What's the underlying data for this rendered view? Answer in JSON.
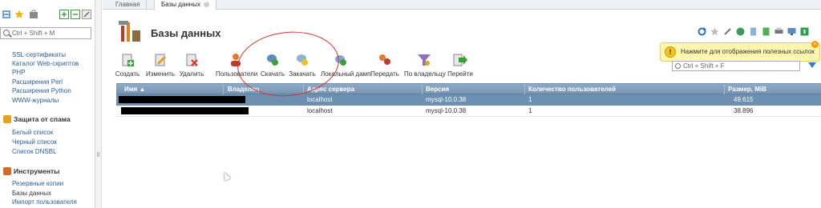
{
  "sidebar": {
    "search_placeholder": "Ctrl + Shift + M",
    "links_top": [
      "SSL-сертификаты",
      "Каталог Web-скриптов",
      "PHP",
      "Расширения Perl",
      "Расширения Python",
      "WWW-журналы"
    ],
    "sections": [
      {
        "title": "Защита от спама",
        "items": [
          "Белый список",
          "Черный список",
          "Список DNSBL"
        ]
      },
      {
        "title": "Инструменты",
        "items": [
          "Резервные копии",
          "Базы данных",
          "Импорт пользователя"
        ]
      }
    ]
  },
  "tabs": [
    {
      "label": "Главная"
    },
    {
      "label": "Базы данных"
    }
  ],
  "page": {
    "title": "Базы данных"
  },
  "tooltip": {
    "text": "Нажмите для отображения полезных ссылок"
  },
  "toolbar": [
    {
      "label": "Создать"
    },
    {
      "label": "Изменить"
    },
    {
      "label": "Удалить"
    },
    {
      "label": "Пользователи"
    },
    {
      "label": "Скачать"
    },
    {
      "label": "Закачать"
    },
    {
      "label": "Локальный дамп"
    },
    {
      "label": "Передать"
    },
    {
      "label": "По владельцу"
    },
    {
      "label": "Перейти"
    }
  ],
  "filter": {
    "placeholder": "Ctrl + Shift + F"
  },
  "table": {
    "columns": [
      "Имя ▲",
      "Владелец",
      "Адрес сервера",
      "Версия",
      "Количество пользователей",
      "Размер, MiB"
    ],
    "rows": [
      {
        "server": "localhost",
        "version": "mysql-10.0.38",
        "users": "1",
        "size": "49.615",
        "selected": true
      },
      {
        "server": "localhost",
        "version": "mysql-10.0.38",
        "users": "1",
        "size": "38.896",
        "selected": false
      }
    ]
  },
  "colors": {
    "header": "#7f9bb8",
    "selected_row": "#6d8fb2",
    "annotation": "#d9342b",
    "tooltip_bg": "#fff6b0"
  }
}
